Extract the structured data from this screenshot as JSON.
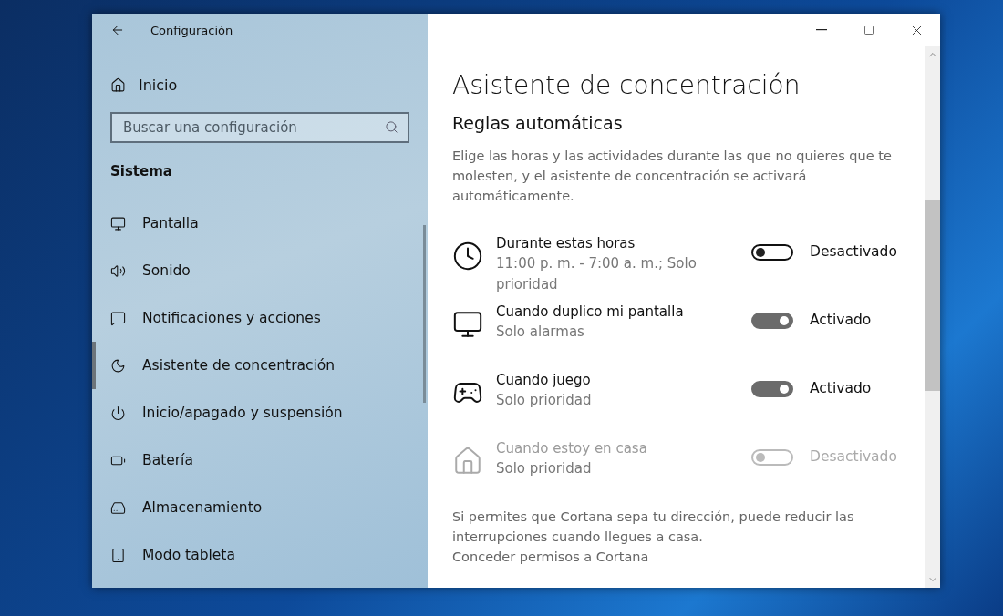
{
  "window": {
    "title": "Configuración"
  },
  "sidebar": {
    "home": "Inicio",
    "search": {
      "placeholder": "Buscar una configuración"
    },
    "section": "Sistema",
    "items": [
      {
        "label": "Pantalla",
        "selected": false
      },
      {
        "label": "Sonido",
        "selected": false
      },
      {
        "label": "Notificaciones y acciones",
        "selected": false
      },
      {
        "label": "Asistente de concentración",
        "selected": true
      },
      {
        "label": "Inicio/apagado y suspensión",
        "selected": false
      },
      {
        "label": "Batería",
        "selected": false
      },
      {
        "label": "Almacenamiento",
        "selected": false
      },
      {
        "label": "Modo tableta",
        "selected": false
      }
    ]
  },
  "content": {
    "title": "Asistente de concentración",
    "section": "Reglas automáticas",
    "description": "Elige las horas y las actividades durante las que no quieres que te molesten, y el asistente de concentración se activará automáticamente.",
    "rules": [
      {
        "title": "Durante estas horas",
        "subtitle": "11:00 p. m. - 7:00 a. m.; Solo prioridad",
        "on": false,
        "disabled": false,
        "state": "Desactivado"
      },
      {
        "title": "Cuando duplico mi pantalla",
        "subtitle": "Solo alarmas",
        "on": true,
        "disabled": false,
        "state": "Activado"
      },
      {
        "title": "Cuando juego",
        "subtitle": "Solo prioridad",
        "on": true,
        "disabled": false,
        "state": "Activado"
      },
      {
        "title": "Cuando estoy en casa",
        "subtitle": "Solo prioridad",
        "on": false,
        "disabled": true,
        "state": "Desactivado"
      }
    ],
    "note": "Si permites que Cortana sepa tu dirección, puede reducir las interrupciones cuando llegues a casa.",
    "link": "Conceder permisos a Cortana"
  }
}
